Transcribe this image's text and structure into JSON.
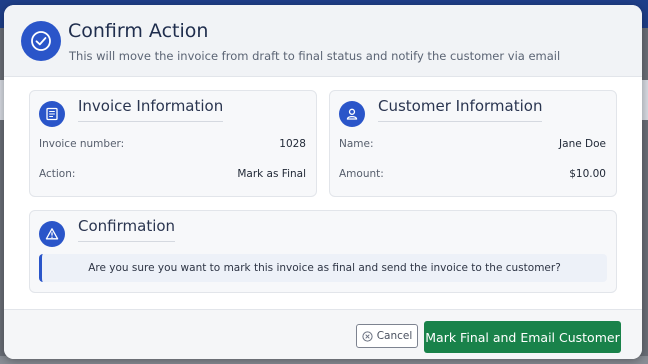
{
  "modal": {
    "title": "Confirm Action",
    "subtitle": "This will move the invoice from draft to final status and notify the customer via email"
  },
  "invoice_card": {
    "title": "Invoice Information",
    "rows": [
      {
        "label": "Invoice number:",
        "value": "1028"
      },
      {
        "label": "Action:",
        "value": "Mark as Final"
      }
    ]
  },
  "customer_card": {
    "title": "Customer Information",
    "rows": [
      {
        "label": "Name:",
        "value": "Jane Doe"
      },
      {
        "label": "Amount:",
        "value": "$10.00"
      }
    ]
  },
  "confirmation_card": {
    "title": "Confirmation",
    "message": "Are you sure you want to mark this invoice as final and send the invoice to the customer?"
  },
  "footer": {
    "cancel_label": "Cancel",
    "primary_label": "Mark Final and Email Customer"
  },
  "colors": {
    "accent": "#2a55c9",
    "primary_button": "#19824a"
  },
  "icons": {
    "header": "check-circle-icon",
    "invoice": "document-icon",
    "customer": "user-icon",
    "confirmation": "warning-icon",
    "cancel": "x-circle-icon"
  }
}
